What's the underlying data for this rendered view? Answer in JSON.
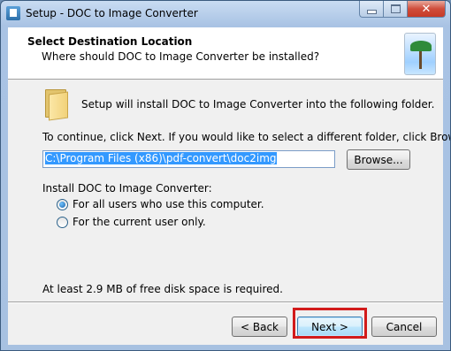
{
  "window": {
    "title": "Setup - DOC to Image Converter",
    "close_glyph": "✕"
  },
  "header": {
    "title": "Select Destination Location",
    "subtitle": "Where should DOC to Image Converter be installed?"
  },
  "body": {
    "intro_text": "Setup will install DOC to Image Converter into the following folder.",
    "instruction_text": "To continue, click Next. If you would like to select a different folder, click Browse.",
    "path_value": "C:\\Program Files (x86)\\pdf-convert\\doc2img",
    "browse_label": "Browse...",
    "install_label": "Install DOC to Image Converter:",
    "options": [
      {
        "label": "For all users who use this computer.",
        "checked": true
      },
      {
        "label": "For the current user only.",
        "checked": false
      }
    ],
    "disk_space_text": "At least 2.9 MB of free disk space is required."
  },
  "footer": {
    "back_label": "< Back",
    "next_label": "Next >",
    "cancel_label": "Cancel"
  },
  "colors": {
    "highlight_border": "#d21b1b",
    "selection": "#3399ff"
  },
  "icons": [
    "setup-app-icon",
    "palm-tree-logo-icon",
    "folder-icon",
    "minimize-icon",
    "maximize-icon",
    "close-icon"
  ]
}
